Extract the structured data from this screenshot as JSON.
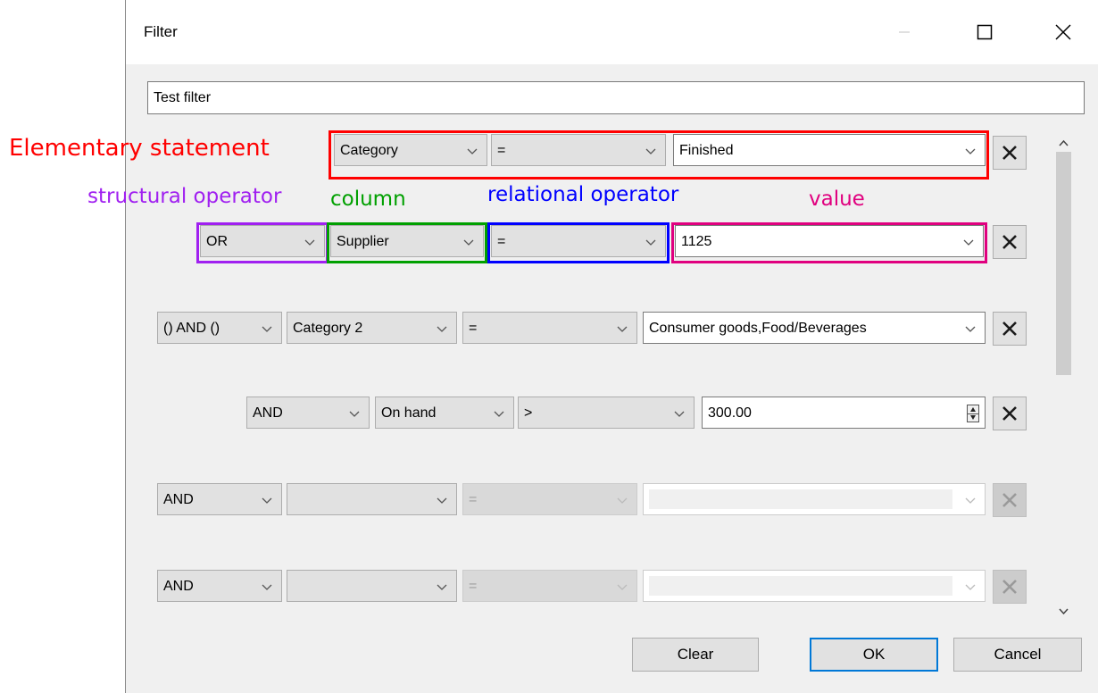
{
  "window": {
    "title": "Filter",
    "minimize_icon": "minimize-icon",
    "maximize_icon": "maximize-icon",
    "close_icon": "close-icon"
  },
  "filter_name": {
    "value": "Test filter"
  },
  "rows": [
    {
      "structural": "",
      "column": "Category",
      "relational": "=",
      "value": "Finished"
    },
    {
      "structural": "OR",
      "column": "Supplier",
      "relational": "=",
      "value": "1125"
    },
    {
      "structural": "() AND ()",
      "column": "Category 2",
      "relational": "=",
      "value": "Consumer goods,Food/Beverages"
    },
    {
      "structural": "AND",
      "column": "On hand",
      "relational": ">",
      "value": "300.00"
    },
    {
      "structural": "AND",
      "column": "",
      "relational": "=",
      "value": ""
    },
    {
      "structural": "AND",
      "column": "",
      "relational": "=",
      "value": ""
    }
  ],
  "annotations": {
    "elementary": {
      "text": "Elementary statement",
      "color": "#ff0000"
    },
    "structural": {
      "text": "structural operator",
      "color": "#a020f0"
    },
    "column": {
      "text": "column",
      "color": "#00a000"
    },
    "relational": {
      "text": "relational operator",
      "color": "#0000ff"
    },
    "value": {
      "text": "value",
      "color": "#e0007f"
    }
  },
  "buttons": {
    "clear": "Clear",
    "ok": "OK",
    "cancel": "Cancel"
  },
  "colors": {
    "accent": "#0078d7"
  }
}
